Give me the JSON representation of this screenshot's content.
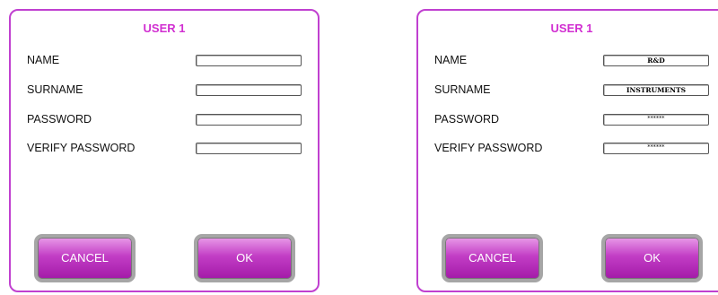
{
  "colors": {
    "accent": "#c040d0",
    "title": "#d12fd1",
    "button_top": "#e89ae8",
    "button_bottom": "#a31aa8"
  },
  "panels": [
    {
      "title": "USER 1",
      "fields": [
        {
          "label": "NAME",
          "value": ""
        },
        {
          "label": "SURNAME",
          "value": ""
        },
        {
          "label": "PASSWORD",
          "value": ""
        },
        {
          "label": "VERIFY PASSWORD",
          "value": ""
        }
      ],
      "buttons": {
        "cancel": "CANCEL",
        "ok": "OK"
      }
    },
    {
      "title": "USER 1",
      "fields": [
        {
          "label": "NAME",
          "value": "R&D"
        },
        {
          "label": "SURNAME",
          "value": "INSTRUMENTS"
        },
        {
          "label": "PASSWORD",
          "value": "******"
        },
        {
          "label": "VERIFY PASSWORD",
          "value": "******"
        }
      ],
      "buttons": {
        "cancel": "CANCEL",
        "ok": "OK"
      }
    }
  ]
}
